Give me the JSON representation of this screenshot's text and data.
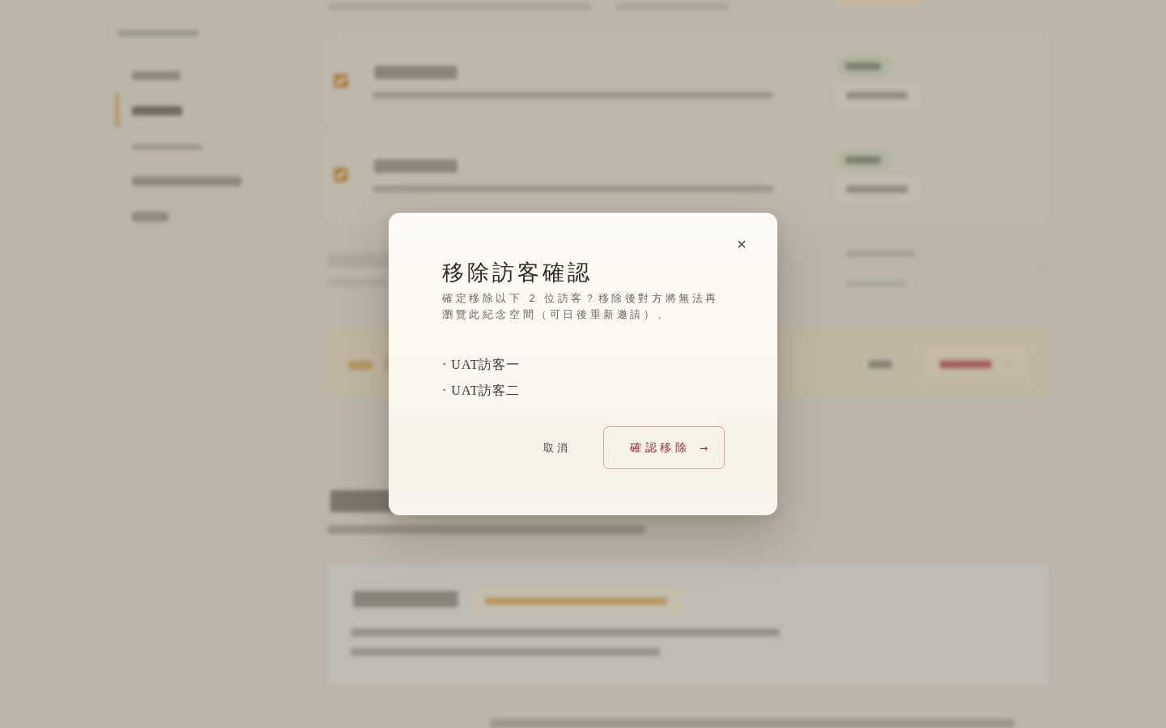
{
  "dialog": {
    "close": "×",
    "title": "移除訪客確認",
    "message": "確定移除以下 2 位訪客？移除後對方將無法再瀏覽此紀念空間（可日後重新邀請）。",
    "guests": [
      "· UAT訪客一",
      "· UAT訪客二"
    ],
    "cancel_button": "取消",
    "confirm_button": {
      "label": "確認移除",
      "arrow": "→"
    }
  }
}
